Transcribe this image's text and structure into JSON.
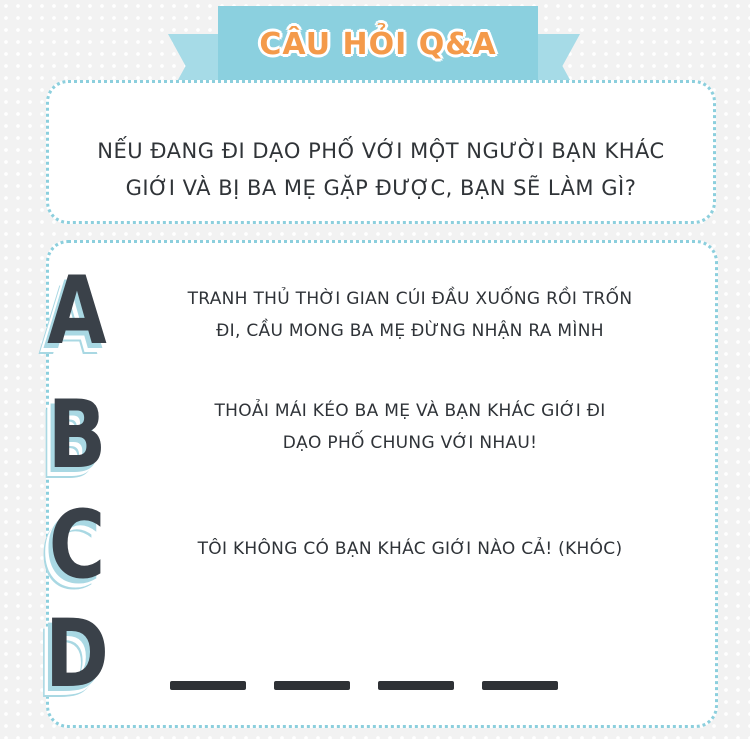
{
  "banner": {
    "title": "CÂU HỎI Q&A"
  },
  "question": {
    "line1": "NẾU ĐANG ĐI DẠO PHỐ VỚI MỘT NGƯỜI BẠN KHÁC",
    "line2": "GIỚI VÀ BỊ BA MẸ GẶP ĐƯỢC, BẠN SẼ LÀM GÌ?"
  },
  "options": [
    {
      "letter": "A",
      "line1": "TRANH THỦ THỜI GIAN CÚI ĐẦU XUỐNG RỒI TRỐN",
      "line2": "ĐI, CẦU MONG BA MẸ ĐỪNG NHẬN RA MÌNH"
    },
    {
      "letter": "B",
      "line1": "THOẢI MÁI KÉO BA MẸ VÀ BẠN KHÁC GIỚI ĐI",
      "line2": "DẠO PHỐ CHUNG VỚI NHAU!"
    },
    {
      "letter": "C",
      "line1": "TÔI KHÔNG CÓ BẠN KHÁC GIỚI NÀO CẢ! (KHÓC)"
    },
    {
      "letter": "D"
    }
  ],
  "colors": {
    "banner": "#8bd0df",
    "title": "#f49a4a",
    "border": "#8ccfdd",
    "text": "#303438"
  }
}
